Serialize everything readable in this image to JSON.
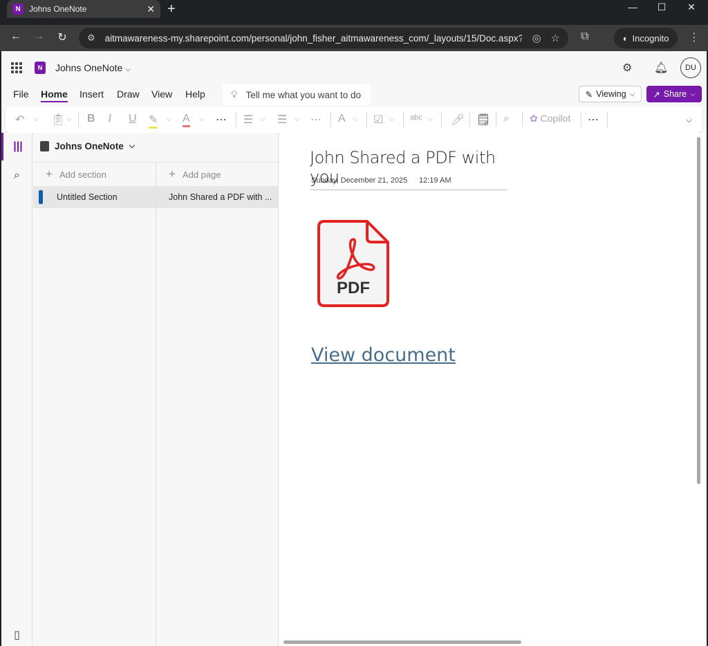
{
  "browser": {
    "tab_title": "Johns OneNote",
    "tab_favicon_letter": "N",
    "url": "aitmawareness-my.sharepoint.com/personal/john_fisher_aitmawareness_com/_layouts/15/Doc.aspx?s...",
    "incognito_label": "Incognito"
  },
  "appbar": {
    "logo_letter": "N",
    "notebook_title": "Johns OneNote",
    "avatar_initials": "DU"
  },
  "menu": {
    "items": [
      "File",
      "Home",
      "Insert",
      "Draw",
      "View",
      "Help"
    ],
    "active": "Home",
    "tell_me_placeholder": "Tell me what you want to do",
    "viewing_label": "Viewing",
    "share_label": "Share"
  },
  "ribbon": {
    "copilot_label": "Copilot"
  },
  "nav": {
    "notebook_name": "Johns OneNote",
    "add_section_label": "Add section",
    "add_page_label": "Add page",
    "sections": [
      {
        "label": "Untitled Section",
        "color": "#0f5fa8"
      }
    ],
    "pages": [
      {
        "label": "John Shared a PDF with ..."
      }
    ]
  },
  "page": {
    "title": "John Shared a PDF with you",
    "date": "Sunday, December 21, 2025",
    "time": "12:19 AM",
    "pdf_label": "PDF",
    "link_text": "View document"
  },
  "colors": {
    "accent": "#7719aa",
    "pdf_red": "#e22323",
    "link": "#4a6e8a"
  }
}
